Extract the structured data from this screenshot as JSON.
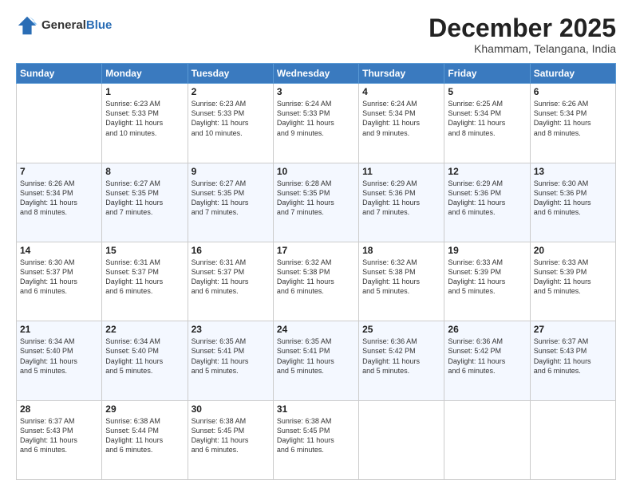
{
  "header": {
    "logo_general": "General",
    "logo_blue": "Blue",
    "month": "December 2025",
    "location": "Khammam, Telangana, India"
  },
  "days_of_week": [
    "Sunday",
    "Monday",
    "Tuesday",
    "Wednesday",
    "Thursday",
    "Friday",
    "Saturday"
  ],
  "weeks": [
    [
      {
        "day": "",
        "info": ""
      },
      {
        "day": "1",
        "info": "Sunrise: 6:23 AM\nSunset: 5:33 PM\nDaylight: 11 hours\nand 10 minutes."
      },
      {
        "day": "2",
        "info": "Sunrise: 6:23 AM\nSunset: 5:33 PM\nDaylight: 11 hours\nand 10 minutes."
      },
      {
        "day": "3",
        "info": "Sunrise: 6:24 AM\nSunset: 5:33 PM\nDaylight: 11 hours\nand 9 minutes."
      },
      {
        "day": "4",
        "info": "Sunrise: 6:24 AM\nSunset: 5:34 PM\nDaylight: 11 hours\nand 9 minutes."
      },
      {
        "day": "5",
        "info": "Sunrise: 6:25 AM\nSunset: 5:34 PM\nDaylight: 11 hours\nand 8 minutes."
      },
      {
        "day": "6",
        "info": "Sunrise: 6:26 AM\nSunset: 5:34 PM\nDaylight: 11 hours\nand 8 minutes."
      }
    ],
    [
      {
        "day": "7",
        "info": "Sunrise: 6:26 AM\nSunset: 5:34 PM\nDaylight: 11 hours\nand 8 minutes."
      },
      {
        "day": "8",
        "info": "Sunrise: 6:27 AM\nSunset: 5:35 PM\nDaylight: 11 hours\nand 7 minutes."
      },
      {
        "day": "9",
        "info": "Sunrise: 6:27 AM\nSunset: 5:35 PM\nDaylight: 11 hours\nand 7 minutes."
      },
      {
        "day": "10",
        "info": "Sunrise: 6:28 AM\nSunset: 5:35 PM\nDaylight: 11 hours\nand 7 minutes."
      },
      {
        "day": "11",
        "info": "Sunrise: 6:29 AM\nSunset: 5:36 PM\nDaylight: 11 hours\nand 7 minutes."
      },
      {
        "day": "12",
        "info": "Sunrise: 6:29 AM\nSunset: 5:36 PM\nDaylight: 11 hours\nand 6 minutes."
      },
      {
        "day": "13",
        "info": "Sunrise: 6:30 AM\nSunset: 5:36 PM\nDaylight: 11 hours\nand 6 minutes."
      }
    ],
    [
      {
        "day": "14",
        "info": "Sunrise: 6:30 AM\nSunset: 5:37 PM\nDaylight: 11 hours\nand 6 minutes."
      },
      {
        "day": "15",
        "info": "Sunrise: 6:31 AM\nSunset: 5:37 PM\nDaylight: 11 hours\nand 6 minutes."
      },
      {
        "day": "16",
        "info": "Sunrise: 6:31 AM\nSunset: 5:37 PM\nDaylight: 11 hours\nand 6 minutes."
      },
      {
        "day": "17",
        "info": "Sunrise: 6:32 AM\nSunset: 5:38 PM\nDaylight: 11 hours\nand 6 minutes."
      },
      {
        "day": "18",
        "info": "Sunrise: 6:32 AM\nSunset: 5:38 PM\nDaylight: 11 hours\nand 5 minutes."
      },
      {
        "day": "19",
        "info": "Sunrise: 6:33 AM\nSunset: 5:39 PM\nDaylight: 11 hours\nand 5 minutes."
      },
      {
        "day": "20",
        "info": "Sunrise: 6:33 AM\nSunset: 5:39 PM\nDaylight: 11 hours\nand 5 minutes."
      }
    ],
    [
      {
        "day": "21",
        "info": "Sunrise: 6:34 AM\nSunset: 5:40 PM\nDaylight: 11 hours\nand 5 minutes."
      },
      {
        "day": "22",
        "info": "Sunrise: 6:34 AM\nSunset: 5:40 PM\nDaylight: 11 hours\nand 5 minutes."
      },
      {
        "day": "23",
        "info": "Sunrise: 6:35 AM\nSunset: 5:41 PM\nDaylight: 11 hours\nand 5 minutes."
      },
      {
        "day": "24",
        "info": "Sunrise: 6:35 AM\nSunset: 5:41 PM\nDaylight: 11 hours\nand 5 minutes."
      },
      {
        "day": "25",
        "info": "Sunrise: 6:36 AM\nSunset: 5:42 PM\nDaylight: 11 hours\nand 5 minutes."
      },
      {
        "day": "26",
        "info": "Sunrise: 6:36 AM\nSunset: 5:42 PM\nDaylight: 11 hours\nand 6 minutes."
      },
      {
        "day": "27",
        "info": "Sunrise: 6:37 AM\nSunset: 5:43 PM\nDaylight: 11 hours\nand 6 minutes."
      }
    ],
    [
      {
        "day": "28",
        "info": "Sunrise: 6:37 AM\nSunset: 5:43 PM\nDaylight: 11 hours\nand 6 minutes."
      },
      {
        "day": "29",
        "info": "Sunrise: 6:38 AM\nSunset: 5:44 PM\nDaylight: 11 hours\nand 6 minutes."
      },
      {
        "day": "30",
        "info": "Sunrise: 6:38 AM\nSunset: 5:45 PM\nDaylight: 11 hours\nand 6 minutes."
      },
      {
        "day": "31",
        "info": "Sunrise: 6:38 AM\nSunset: 5:45 PM\nDaylight: 11 hours\nand 6 minutes."
      },
      {
        "day": "",
        "info": ""
      },
      {
        "day": "",
        "info": ""
      },
      {
        "day": "",
        "info": ""
      }
    ]
  ]
}
